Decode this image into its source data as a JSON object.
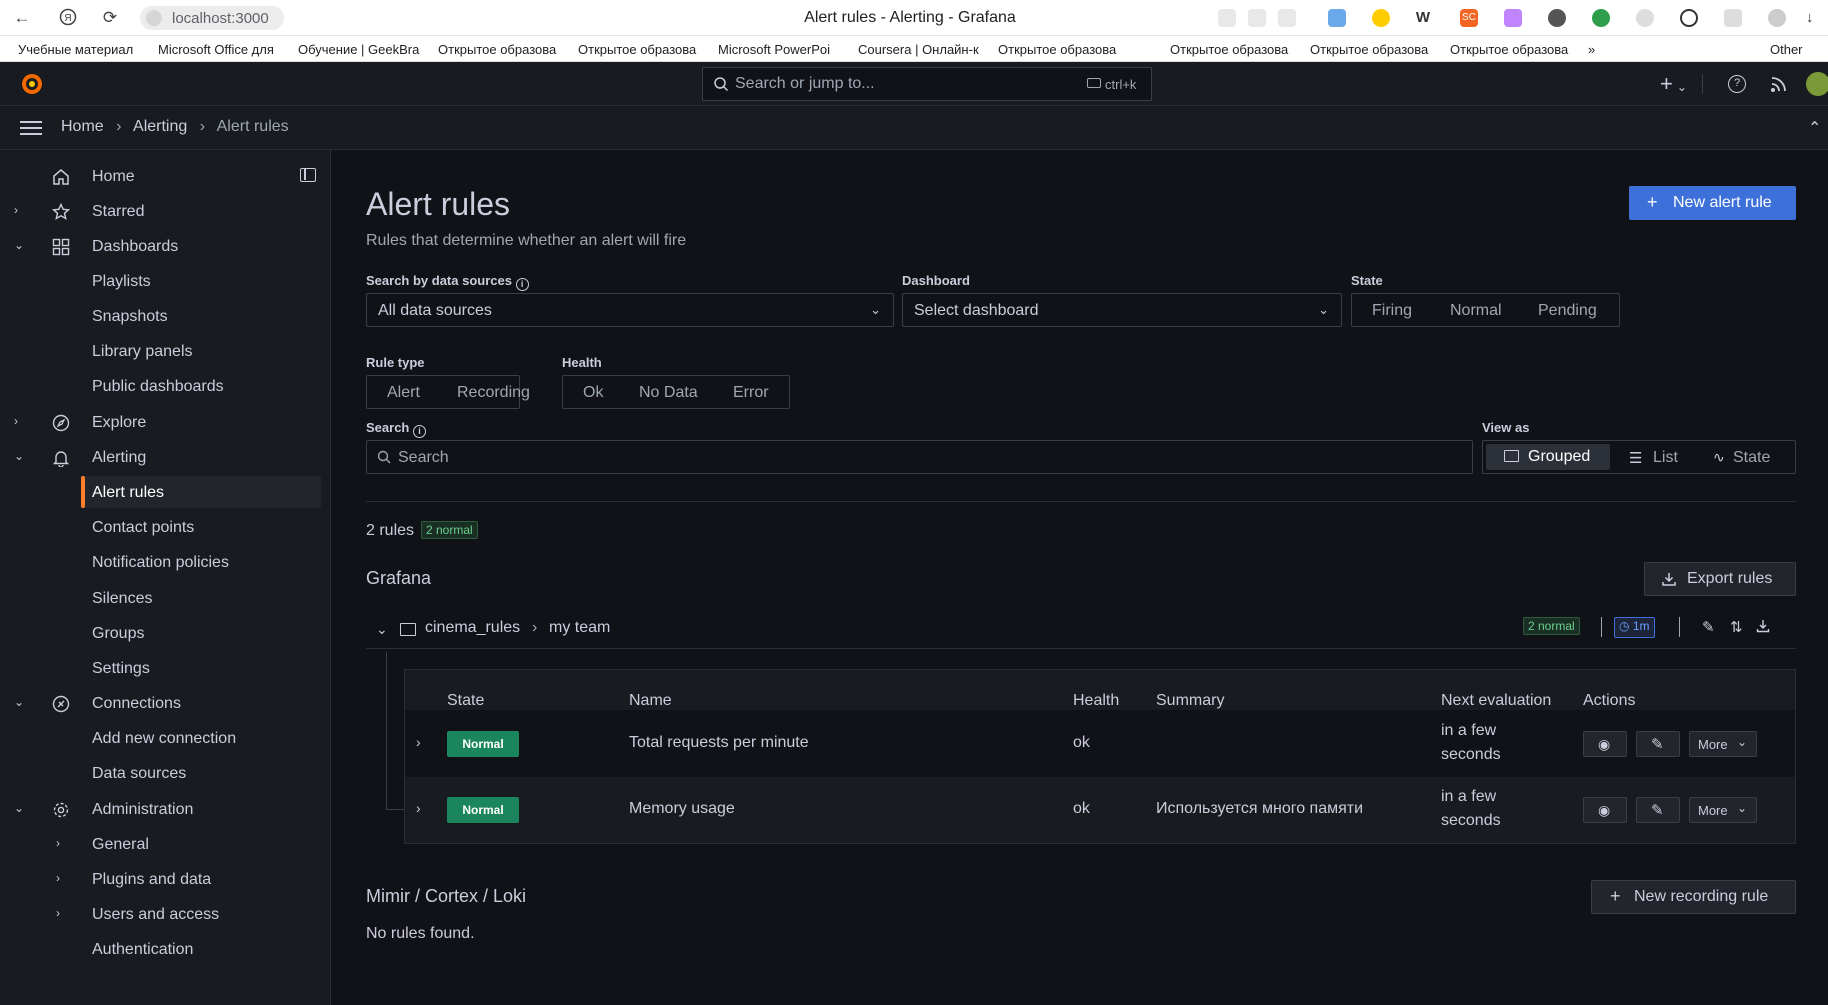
{
  "browser": {
    "url": "localhost:3000",
    "tab_title": "Alert rules - Alerting - Grafana",
    "bookmarks": [
      "Учебные материал",
      "Microsoft Office для",
      "Обучение | GeekBra",
      "Открытое образова",
      "Открытое образова",
      "Microsoft PowerPoi",
      "Coursera | Онлайн-к",
      "Открытое образова",
      "Открытое образова",
      "Открытое образова",
      "Открытое образова"
    ],
    "bookmarks_more": "»",
    "bookmarks_other": "Other"
  },
  "topbar": {
    "search_placeholder": "Search or jump to...",
    "search_shortcut": "ctrl+k",
    "add_label": "+"
  },
  "breadcrumb": {
    "items": [
      "Home",
      "Alerting",
      "Alert rules"
    ]
  },
  "sidebar": {
    "items": [
      {
        "label": "Home"
      },
      {
        "label": "Starred"
      },
      {
        "label": "Dashboards"
      },
      {
        "label": "Playlists"
      },
      {
        "label": "Snapshots"
      },
      {
        "label": "Library panels"
      },
      {
        "label": "Public dashboards"
      },
      {
        "label": "Explore"
      },
      {
        "label": "Alerting"
      },
      {
        "label": "Alert rules"
      },
      {
        "label": "Contact points"
      },
      {
        "label": "Notification policies"
      },
      {
        "label": "Silences"
      },
      {
        "label": "Groups"
      },
      {
        "label": "Settings"
      },
      {
        "label": "Connections"
      },
      {
        "label": "Add new connection"
      },
      {
        "label": "Data sources"
      },
      {
        "label": "Administration"
      },
      {
        "label": "General"
      },
      {
        "label": "Plugins and data"
      },
      {
        "label": "Users and access"
      },
      {
        "label": "Authentication"
      }
    ]
  },
  "page": {
    "title": "Alert rules",
    "subtitle": "Rules that determine whether an alert will fire",
    "new_alert_rule": "New alert rule"
  },
  "filters": {
    "datasource_label": "Search by data sources",
    "datasource_value": "All data sources",
    "dashboard_label": "Dashboard",
    "dashboard_placeholder": "Select dashboard",
    "state_label": "State",
    "state_options": [
      "Firing",
      "Normal",
      "Pending"
    ],
    "rule_type_label": "Rule type",
    "rule_type_options": [
      "Alert",
      "Recording"
    ],
    "health_label": "Health",
    "health_options": [
      "Ok",
      "No Data",
      "Error"
    ],
    "search_label": "Search",
    "search_placeholder": "Search",
    "view_as_label": "View as",
    "view_as_options": [
      "Grouped",
      "List",
      "State"
    ]
  },
  "summary": {
    "rules_count": "2 rules",
    "normal_badge": "2 normal"
  },
  "grafana_section": {
    "title": "Grafana",
    "export_label": "Export rules",
    "group": {
      "folder": "cinema_rules",
      "name": "my team",
      "normal_badge": "2 normal",
      "interval": "1m"
    },
    "table": {
      "headers": [
        "State",
        "Name",
        "Health",
        "Summary",
        "Next evaluation",
        "Actions"
      ],
      "rows": [
        {
          "state": "Normal",
          "name": "Total requests per minute",
          "health": "ok",
          "summary": "",
          "next_eval_1": "in a few",
          "next_eval_2": "seconds",
          "more": "More"
        },
        {
          "state": "Normal",
          "name": "Memory usage",
          "health": "ok",
          "summary": "Используется много памяти",
          "next_eval_1": "in a few",
          "next_eval_2": "seconds",
          "more": "More"
        }
      ]
    }
  },
  "mimir_section": {
    "title": "Mimir / Cortex / Loki",
    "new_recording_rule": "New recording rule",
    "empty": "No rules found."
  },
  "colors": {
    "bg": "#111217",
    "panel": "#181b1f",
    "primary": "#3d71d9",
    "normal": "#1b855e",
    "active_accent": "#ff7f2a"
  }
}
